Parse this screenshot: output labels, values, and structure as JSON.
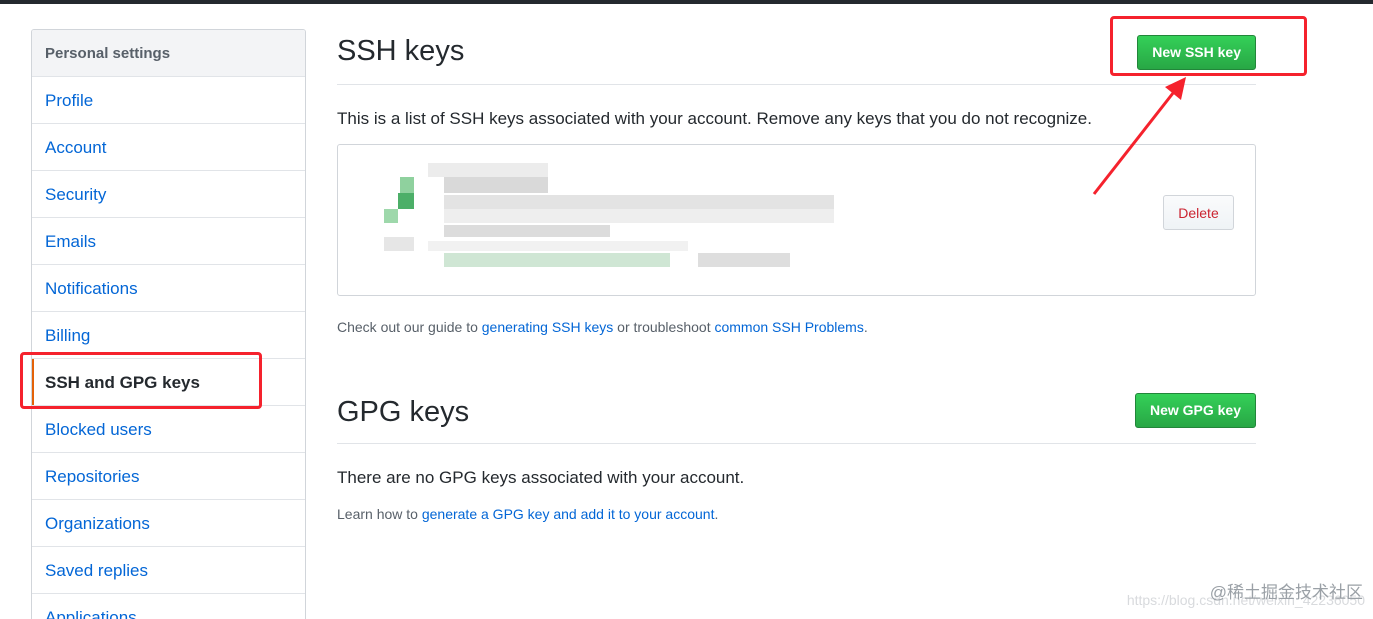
{
  "sidebar": {
    "header": "Personal settings",
    "items": [
      {
        "label": "Profile"
      },
      {
        "label": "Account"
      },
      {
        "label": "Security"
      },
      {
        "label": "Emails"
      },
      {
        "label": "Notifications"
      },
      {
        "label": "Billing"
      },
      {
        "label": "SSH and GPG keys",
        "selected": true
      },
      {
        "label": "Blocked users"
      },
      {
        "label": "Repositories"
      },
      {
        "label": "Organizations"
      },
      {
        "label": "Saved replies"
      },
      {
        "label": "Applications"
      }
    ]
  },
  "ssh": {
    "title": "SSH keys",
    "new_button": "New SSH key",
    "description": "This is a list of SSH keys associated with your account. Remove any keys that you do not recognize.",
    "delete_button": "Delete",
    "guide": {
      "prefix": "Check out our guide to ",
      "link1": "generating SSH keys",
      "middle": " or troubleshoot ",
      "link2": "common SSH Problems",
      "suffix": "."
    }
  },
  "gpg": {
    "title": "GPG keys",
    "new_button": "New GPG key",
    "empty_text": "There are no GPG keys associated with your account.",
    "learn": {
      "prefix": "Learn how to ",
      "link": "generate a GPG key and add it to your account",
      "suffix": "."
    }
  },
  "watermark": {
    "brand": "@稀土掘金技术社区",
    "url": "https://blog.csdn.net/weixin_42236050"
  },
  "colors": {
    "link": "#0366d6",
    "green_button": "#28a745",
    "annotation_red": "#f5222d",
    "active_marker": "#e36209",
    "delete_text": "#cb2431"
  }
}
